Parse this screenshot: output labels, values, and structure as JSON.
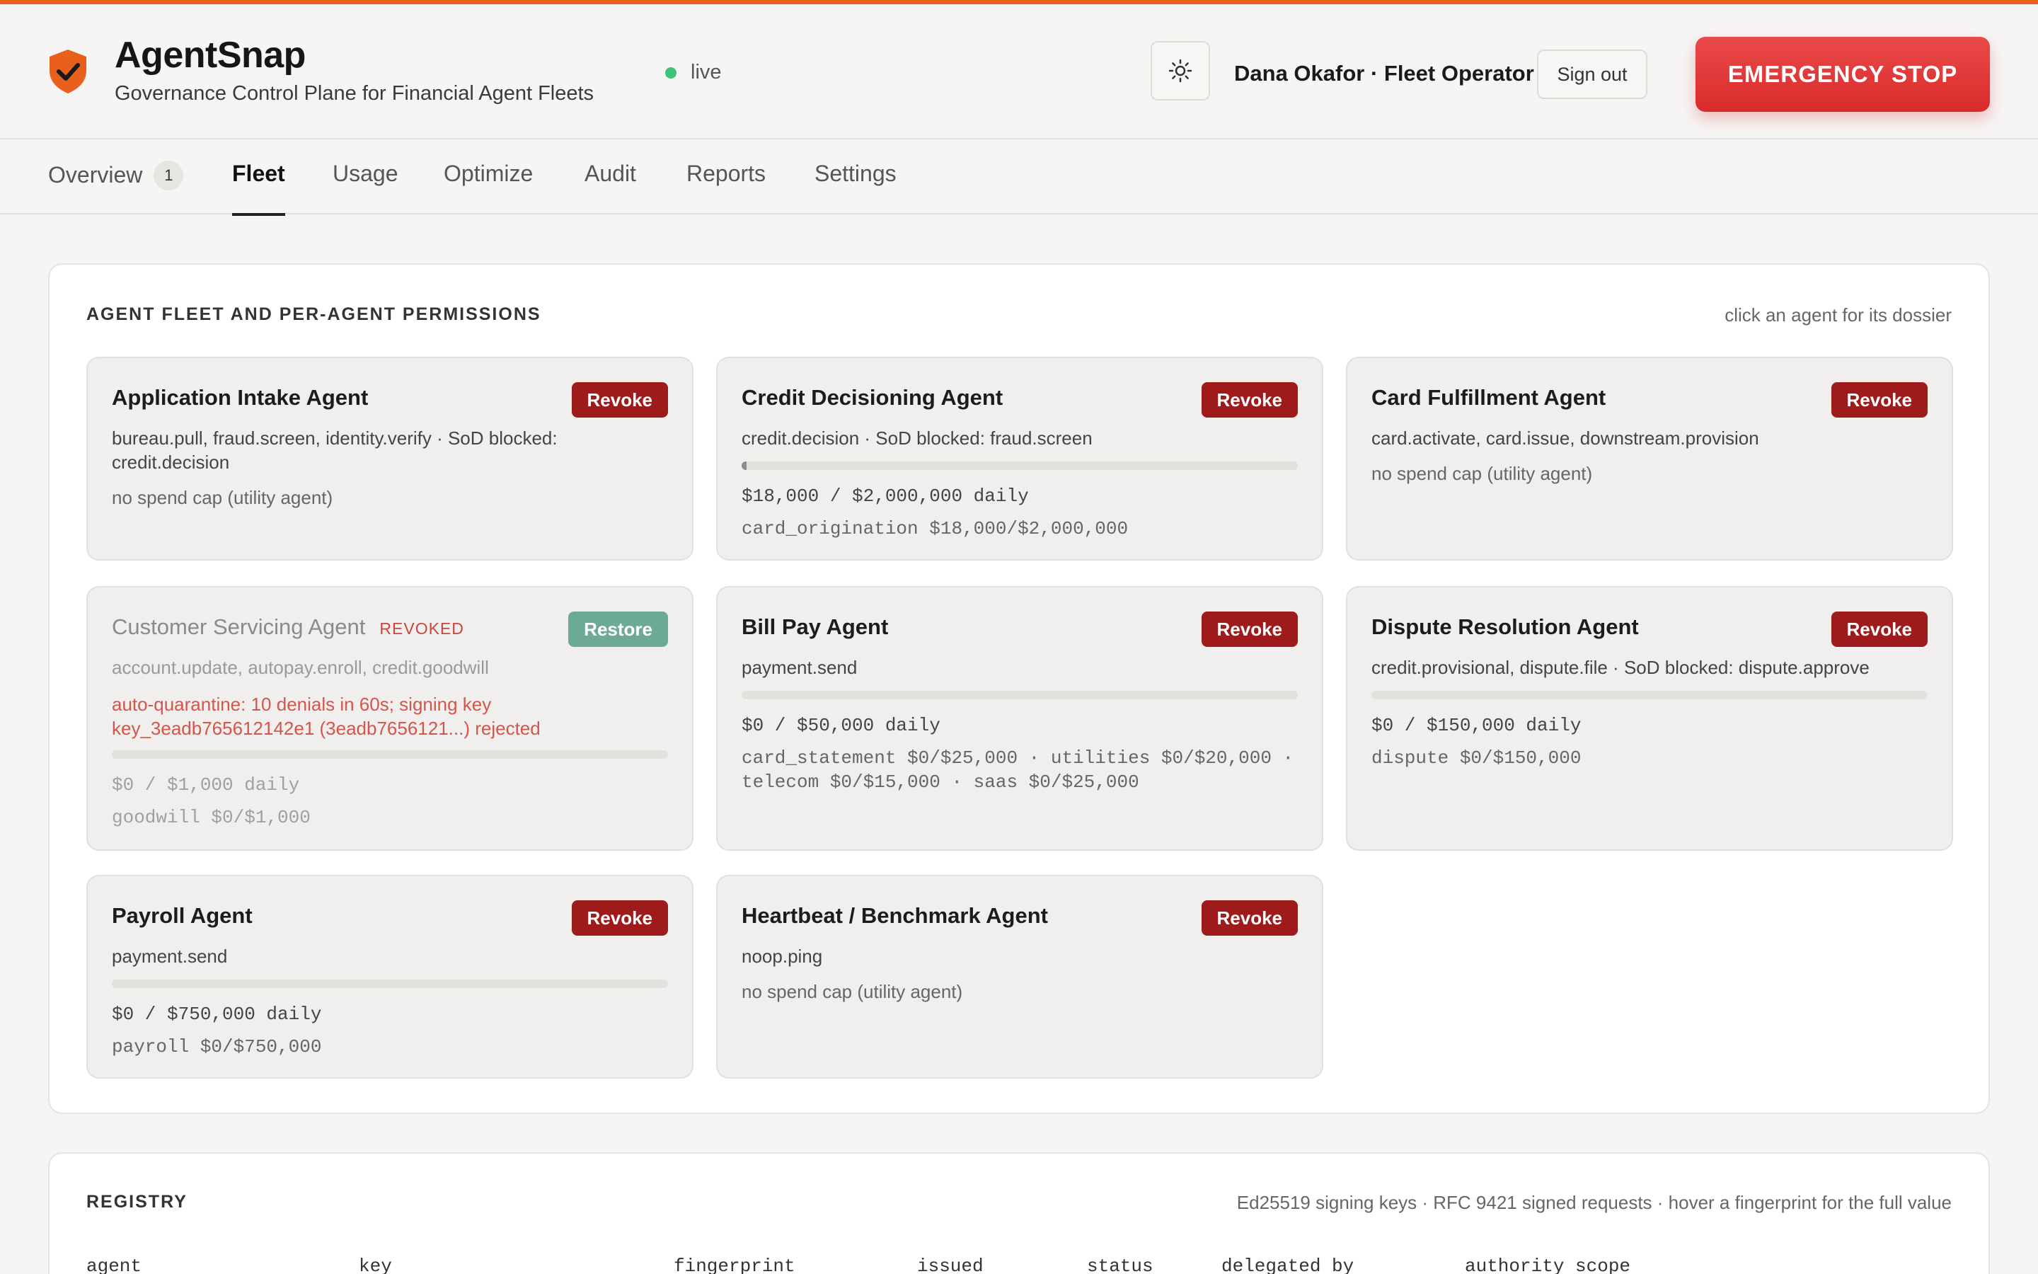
{
  "header": {
    "title": "AgentSnap",
    "subtitle": "Governance Control Plane for Financial Agent Fleets",
    "status": "live",
    "user": "Dana Okafor · Fleet Operator",
    "signout_label": "Sign out",
    "emergency_label": "EMERGENCY STOP"
  },
  "tabs": [
    {
      "label": "Overview",
      "badge": "1"
    },
    {
      "label": "Fleet"
    },
    {
      "label": "Usage"
    },
    {
      "label": "Optimize"
    },
    {
      "label": "Audit"
    },
    {
      "label": "Reports"
    },
    {
      "label": "Settings"
    }
  ],
  "fleet": {
    "title": "AGENT FLEET AND PER-AGENT PERMISSIONS",
    "hint": "click an agent for its dossier",
    "agents": [
      {
        "name": "Application Intake Agent",
        "action": "Revoke",
        "perms": "bureau.pull, fraud.screen, identity.verify · SoD blocked: credit.decision",
        "note": "no spend cap (utility agent)"
      },
      {
        "name": "Credit Decisioning Agent",
        "action": "Revoke",
        "perms": "credit.decision · SoD blocked: fraud.screen",
        "usage": 0.009,
        "spend": "$18,000 / $2,000,000 daily",
        "breakdown": "card_origination $18,000/$2,000,000"
      },
      {
        "name": "Card Fulfillment Agent",
        "action": "Revoke",
        "perms": "card.activate, card.issue, downstream.provision",
        "note": "no spend cap (utility agent)"
      },
      {
        "name": "Customer Servicing Agent",
        "status": "REVOKED",
        "action": "Restore",
        "perms": "account.update, autopay.enroll, credit.goodwill",
        "warning": "auto-quarantine: 10 denials in 60s; signing key key_3eadb765612142e1 (3eadb7656121...) rejected",
        "usage": 0,
        "spend": "$0 / $1,000 daily",
        "breakdown": "goodwill $0/$1,000"
      },
      {
        "name": "Bill Pay Agent",
        "action": "Revoke",
        "perms": "payment.send",
        "usage": 0,
        "spend": "$0 / $50,000 daily",
        "breakdown": "card_statement $0/$25,000 · utilities $0/$20,000 · telecom $0/$15,000 · saas $0/$25,000"
      },
      {
        "name": "Dispute Resolution Agent",
        "action": "Revoke",
        "perms": "credit.provisional, dispute.file · SoD blocked: dispute.approve",
        "usage": 0,
        "spend": "$0 / $150,000 daily",
        "breakdown": "dispute $0/$150,000"
      },
      {
        "name": "Payroll Agent",
        "action": "Revoke",
        "perms": "payment.send",
        "usage": 0,
        "spend": "$0 / $750,000 daily",
        "breakdown": "payroll $0/$750,000"
      },
      {
        "name": "Heartbeat / Benchmark Agent",
        "action": "Revoke",
        "perms": "noop.ping",
        "note": "no spend cap (utility agent)"
      }
    ]
  },
  "registry": {
    "title": "REGISTRY",
    "hint": "Ed25519 signing keys · RFC 9421 signed requests · hover a fingerprint for the full value",
    "columns": [
      "agent",
      "key",
      "fingerprint",
      "issued",
      "status",
      "delegated by",
      "authority scope"
    ]
  },
  "colors": {
    "accent": "#e8601c",
    "danger": "#d92a2a",
    "revoke": "#9f1b1b",
    "restore": "#6daa94",
    "live": "#3cc27a"
  }
}
